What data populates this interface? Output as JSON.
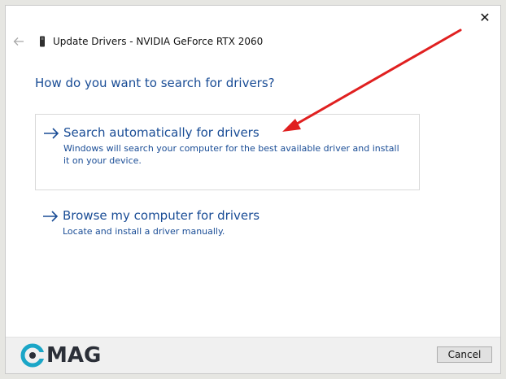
{
  "window": {
    "title": "Update Drivers - NVIDIA GeForce RTX 2060",
    "close_glyph": "✕"
  },
  "question": "How do you want to search for drivers?",
  "options": [
    {
      "title": "Search automatically for drivers",
      "description": "Windows will search your computer for the best available driver and install it on your device."
    },
    {
      "title": "Browse my computer for drivers",
      "description": "Locate and install a driver manually."
    }
  ],
  "footer": {
    "cancel_label": "Cancel",
    "logo_text": "MAG"
  },
  "colors": {
    "link_blue": "#1a4d96",
    "annotation_red": "#e02020",
    "logo_teal": "#1ba6c7",
    "logo_dark": "#2b2f38"
  },
  "icons": {
    "back": "back-arrow-icon",
    "device": "device-icon",
    "option": "right-arrow-icon",
    "close": "close-icon"
  }
}
